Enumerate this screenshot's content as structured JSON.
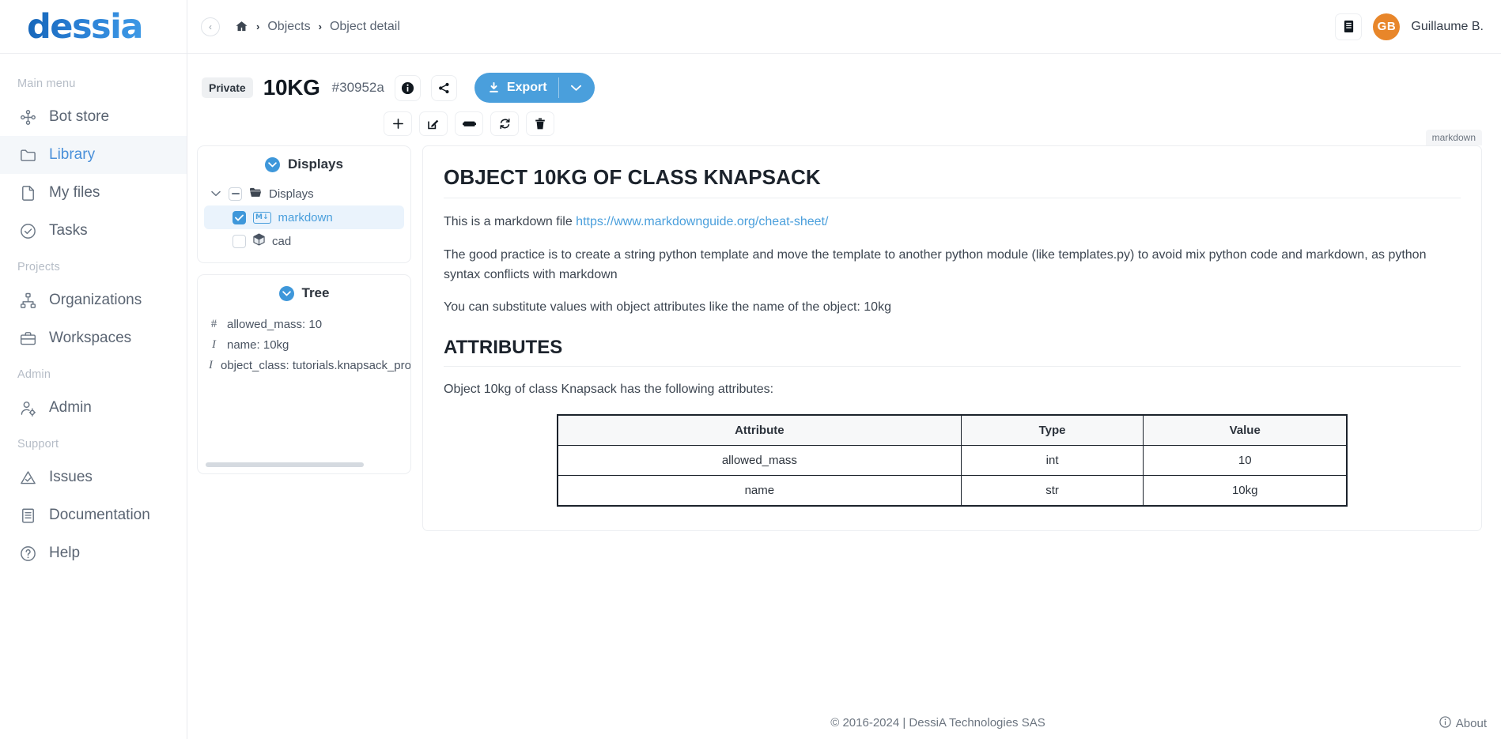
{
  "brand": {
    "logo_text": "dessia"
  },
  "sidebar": {
    "groups": [
      {
        "label": "Main menu",
        "items": [
          {
            "label": "Bot store",
            "icon": "bot-store-icon",
            "active": false
          },
          {
            "label": "Library",
            "icon": "folder-icon",
            "active": true
          },
          {
            "label": "My files",
            "icon": "file-icon",
            "active": false
          },
          {
            "label": "Tasks",
            "icon": "check-circle-icon",
            "active": false
          }
        ]
      },
      {
        "label": "Projects",
        "items": [
          {
            "label": "Organizations",
            "icon": "org-chart-icon",
            "active": false
          },
          {
            "label": "Workspaces",
            "icon": "briefcase-icon",
            "active": false
          }
        ]
      },
      {
        "label": "Admin",
        "items": [
          {
            "label": "Admin",
            "icon": "user-gear-icon",
            "active": false
          }
        ]
      },
      {
        "label": "Support",
        "items": [
          {
            "label": "Issues",
            "icon": "warning-triangle-icon",
            "active": false
          },
          {
            "label": "Documentation",
            "icon": "book-icon",
            "active": false
          },
          {
            "label": "Help",
            "icon": "question-circle-icon",
            "active": false
          }
        ]
      }
    ]
  },
  "topbar": {
    "collapse_label": "‹",
    "breadcrumb": {
      "home_icon": "home-icon",
      "sep": "›",
      "items": [
        "Objects",
        "Object detail"
      ]
    },
    "doc_icon": "document-icon",
    "user": {
      "initials": "GB",
      "name": "Guillaume B."
    }
  },
  "object": {
    "visibility_badge": "Private",
    "title": "10KG",
    "id": "#30952a",
    "info_icon": "info-icon",
    "share_icon": "share-icon",
    "export_label": "Export",
    "export_download_icon": "download-icon",
    "export_caret_icon": "chevron-down-icon",
    "tools": [
      {
        "name": "add-button",
        "icon": "plus-icon"
      },
      {
        "name": "edit-button",
        "icon": "pencil-square-icon"
      },
      {
        "name": "rename-button",
        "icon": "tag-icon"
      },
      {
        "name": "refresh-button",
        "icon": "refresh-icon"
      },
      {
        "name": "delete-button",
        "icon": "trash-icon"
      }
    ]
  },
  "displays_panel": {
    "title": "Displays",
    "collapse_icon": "chevron-down-circle-icon",
    "root": {
      "label": "Displays",
      "icon": "folder-open-icon",
      "expanded": true,
      "checkbox": "indeterminate"
    },
    "children": [
      {
        "label": "markdown",
        "icon": "markdown-icon",
        "checked": true,
        "selected": true
      },
      {
        "label": "cad",
        "icon": "cube-icon",
        "checked": false,
        "selected": false
      }
    ]
  },
  "tree_panel": {
    "title": "Tree",
    "collapse_icon": "chevron-down-circle-icon",
    "attributes": [
      {
        "type_icon": "#",
        "text": "allowed_mass: 10"
      },
      {
        "type_icon": "I",
        "text": "name: 10kg"
      },
      {
        "type_icon": "I",
        "text": "object_class: tutorials.knapsack_prob"
      }
    ]
  },
  "markdown": {
    "tag_label": "markdown",
    "h1": "OBJECT 10KG OF CLASS KNAPSACK",
    "p1_before": "This is a markdown file ",
    "p1_link": "https://www.markdownguide.org/cheat-sheet/",
    "p2": "The good practice is to create a string python template and move the template to another python module (like templates.py) to avoid mix python code and markdown, as python syntax conflicts with markdown",
    "p3": "You can substitute values with object attributes like the name of the object: 10kg",
    "h2": "ATTRIBUTES",
    "p4": "Object 10kg of class Knapsack has the following attributes:",
    "table": {
      "headers": [
        "Attribute",
        "Type",
        "Value"
      ],
      "rows": [
        [
          "allowed_mass",
          "int",
          "10"
        ],
        [
          "name",
          "str",
          "10kg"
        ]
      ]
    }
  },
  "footer": {
    "copyright": "© 2016-2024 | DessiA Technologies SAS",
    "about_label": "About",
    "about_icon": "info-circle-icon"
  },
  "colors": {
    "accent": "#4a9fdc",
    "brand_blue": "#1565b8",
    "avatar_orange": "#e8862a",
    "active_nav": "#4a90d9"
  }
}
